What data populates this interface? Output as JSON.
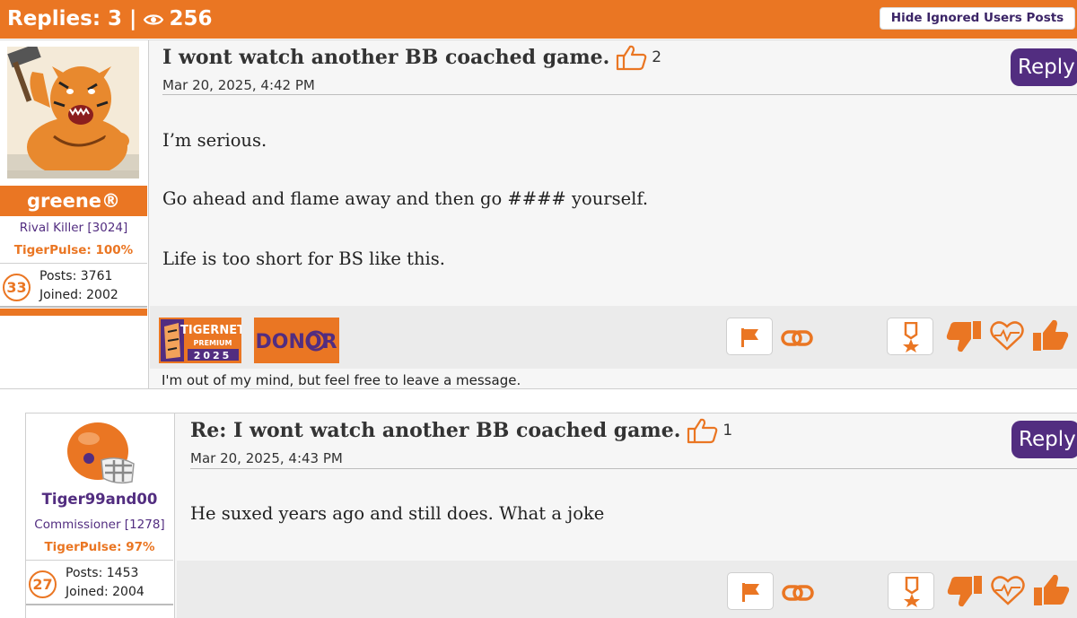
{
  "topic": {
    "replies_label": "Replies: 3",
    "separator": "|",
    "views": "256",
    "views_icon": "eye-icon",
    "hide_ignored_label": "Hide Ignored Users Posts"
  },
  "colors": {
    "orange": "#EA7623",
    "purple": "#522D80",
    "bar_bg": "#ebebeb"
  },
  "posts": [
    {
      "user": {
        "name": "greene®",
        "rank": "Rival Killer [3024]",
        "tigerpulse": "TigerPulse: 100%",
        "level": "33",
        "posts": "Posts: 3761",
        "joined": "Joined: 2002"
      },
      "title": "I wont watch another BB coached game.",
      "likes": "2",
      "date": "Mar 20, 2025, 4:42 PM",
      "reply_label": "Reply",
      "body": [
        "I’m serious.",
        "Go ahead and flame away and then go #### yourself.",
        "Life is too short for BS like this."
      ],
      "badges": {
        "tigernet_title": "TIGERNET",
        "tigernet_sub": "PREMIUM",
        "tigernet_year": "2025",
        "donor": "DONOR"
      },
      "signature": "I'm out of my mind, but feel free to leave a message."
    },
    {
      "user": {
        "name": "Tiger99and00",
        "rank": "Commissioner [1278]",
        "tigerpulse": "TigerPulse: 97%",
        "level": "27",
        "posts": "Posts: 1453",
        "joined": "Joined: 2004"
      },
      "title": "Re: I wont watch another BB coached game.",
      "likes": "1",
      "date": "Mar 20, 2025, 4:43 PM",
      "reply_label": "Reply",
      "body": [
        "He suxed years ago and still does. What a joke"
      ]
    }
  ]
}
